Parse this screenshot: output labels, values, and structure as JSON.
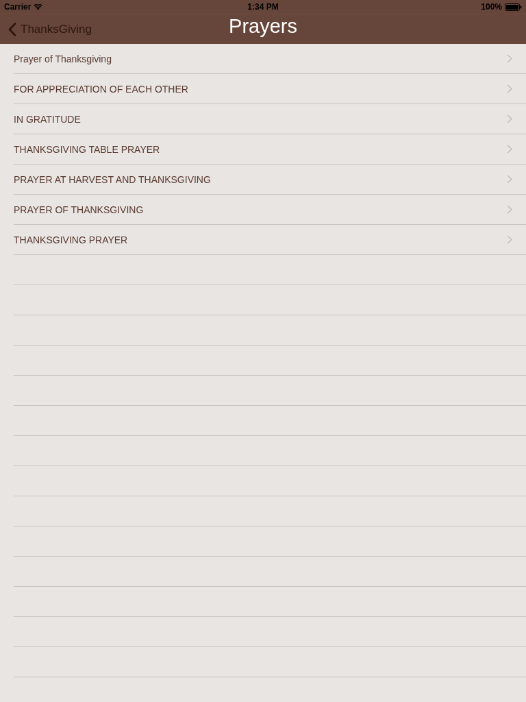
{
  "status_bar": {
    "carrier": "Carrier",
    "time": "1:34 PM",
    "battery": "100%"
  },
  "nav_bar": {
    "back": "ThanksGiving",
    "title": "Prayers"
  },
  "prayers": [
    {
      "title": "Prayer of Thanksgiving"
    },
    {
      "title": "FOR APPRECIATION OF EACH OTHER"
    },
    {
      "title": "IN GRATITUDE"
    },
    {
      "title": "THANKSGIVING TABLE PRAYER"
    },
    {
      "title": "PRAYER AT HARVEST AND THANKSGIVING"
    },
    {
      "title": "PRAYER OF THANKSGIVING"
    },
    {
      "title": "THANKSGIVING PRAYER"
    }
  ]
}
